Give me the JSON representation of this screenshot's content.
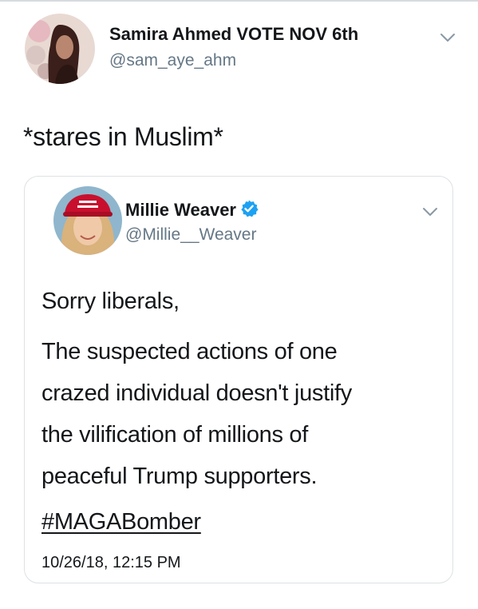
{
  "tweet": {
    "author": {
      "name": "Samira Ahmed VOTE NOV 6th",
      "handle": "@sam_aye_ahm",
      "avatar_icon": "user-photo-avatar"
    },
    "text": "*stares in Muslim*",
    "menu_icon": "chevron-down-icon"
  },
  "quoted_tweet": {
    "author": {
      "name": "Millie Weaver",
      "handle": "@Millie__Weaver",
      "verified": true,
      "verified_icon": "verified-badge-icon",
      "avatar_icon": "user-photo-avatar"
    },
    "menu_icon": "chevron-down-icon",
    "paragraphs": [
      "Sorry liberals,",
      "The suspected actions of one",
      "crazed individual doesn't justify",
      "the vilification of millions of",
      "peaceful Trump supporters."
    ],
    "hashtag": "#MAGABomber",
    "timestamp": "10/26/18, 12:15 PM"
  },
  "colors": {
    "text": "#14171a",
    "secondary_text": "#657786",
    "verified_blue": "#1da1f2",
    "card_border": "#dde2e6"
  }
}
